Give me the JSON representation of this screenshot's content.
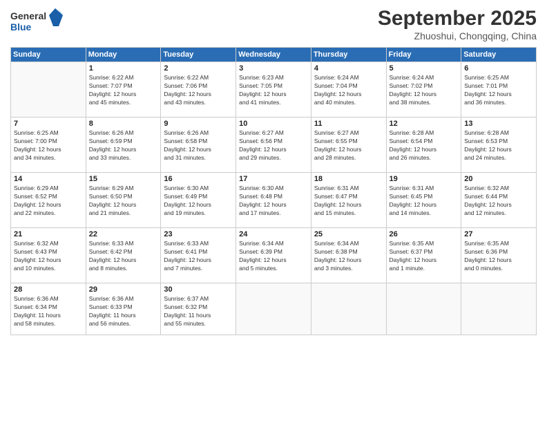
{
  "logo": {
    "line1": "General",
    "line2": "Blue"
  },
  "title": "September 2025",
  "subtitle": "Zhuoshui, Chongqing, China",
  "days_header": [
    "Sunday",
    "Monday",
    "Tuesday",
    "Wednesday",
    "Thursday",
    "Friday",
    "Saturday"
  ],
  "weeks": [
    [
      {
        "day": "",
        "info": ""
      },
      {
        "day": "1",
        "info": "Sunrise: 6:22 AM\nSunset: 7:07 PM\nDaylight: 12 hours\nand 45 minutes."
      },
      {
        "day": "2",
        "info": "Sunrise: 6:22 AM\nSunset: 7:06 PM\nDaylight: 12 hours\nand 43 minutes."
      },
      {
        "day": "3",
        "info": "Sunrise: 6:23 AM\nSunset: 7:05 PM\nDaylight: 12 hours\nand 41 minutes."
      },
      {
        "day": "4",
        "info": "Sunrise: 6:24 AM\nSunset: 7:04 PM\nDaylight: 12 hours\nand 40 minutes."
      },
      {
        "day": "5",
        "info": "Sunrise: 6:24 AM\nSunset: 7:02 PM\nDaylight: 12 hours\nand 38 minutes."
      },
      {
        "day": "6",
        "info": "Sunrise: 6:25 AM\nSunset: 7:01 PM\nDaylight: 12 hours\nand 36 minutes."
      }
    ],
    [
      {
        "day": "7",
        "info": "Sunrise: 6:25 AM\nSunset: 7:00 PM\nDaylight: 12 hours\nand 34 minutes."
      },
      {
        "day": "8",
        "info": "Sunrise: 6:26 AM\nSunset: 6:59 PM\nDaylight: 12 hours\nand 33 minutes."
      },
      {
        "day": "9",
        "info": "Sunrise: 6:26 AM\nSunset: 6:58 PM\nDaylight: 12 hours\nand 31 minutes."
      },
      {
        "day": "10",
        "info": "Sunrise: 6:27 AM\nSunset: 6:56 PM\nDaylight: 12 hours\nand 29 minutes."
      },
      {
        "day": "11",
        "info": "Sunrise: 6:27 AM\nSunset: 6:55 PM\nDaylight: 12 hours\nand 28 minutes."
      },
      {
        "day": "12",
        "info": "Sunrise: 6:28 AM\nSunset: 6:54 PM\nDaylight: 12 hours\nand 26 minutes."
      },
      {
        "day": "13",
        "info": "Sunrise: 6:28 AM\nSunset: 6:53 PM\nDaylight: 12 hours\nand 24 minutes."
      }
    ],
    [
      {
        "day": "14",
        "info": "Sunrise: 6:29 AM\nSunset: 6:52 PM\nDaylight: 12 hours\nand 22 minutes."
      },
      {
        "day": "15",
        "info": "Sunrise: 6:29 AM\nSunset: 6:50 PM\nDaylight: 12 hours\nand 21 minutes."
      },
      {
        "day": "16",
        "info": "Sunrise: 6:30 AM\nSunset: 6:49 PM\nDaylight: 12 hours\nand 19 minutes."
      },
      {
        "day": "17",
        "info": "Sunrise: 6:30 AM\nSunset: 6:48 PM\nDaylight: 12 hours\nand 17 minutes."
      },
      {
        "day": "18",
        "info": "Sunrise: 6:31 AM\nSunset: 6:47 PM\nDaylight: 12 hours\nand 15 minutes."
      },
      {
        "day": "19",
        "info": "Sunrise: 6:31 AM\nSunset: 6:45 PM\nDaylight: 12 hours\nand 14 minutes."
      },
      {
        "day": "20",
        "info": "Sunrise: 6:32 AM\nSunset: 6:44 PM\nDaylight: 12 hours\nand 12 minutes."
      }
    ],
    [
      {
        "day": "21",
        "info": "Sunrise: 6:32 AM\nSunset: 6:43 PM\nDaylight: 12 hours\nand 10 minutes."
      },
      {
        "day": "22",
        "info": "Sunrise: 6:33 AM\nSunset: 6:42 PM\nDaylight: 12 hours\nand 8 minutes."
      },
      {
        "day": "23",
        "info": "Sunrise: 6:33 AM\nSunset: 6:41 PM\nDaylight: 12 hours\nand 7 minutes."
      },
      {
        "day": "24",
        "info": "Sunrise: 6:34 AM\nSunset: 6:39 PM\nDaylight: 12 hours\nand 5 minutes."
      },
      {
        "day": "25",
        "info": "Sunrise: 6:34 AM\nSunset: 6:38 PM\nDaylight: 12 hours\nand 3 minutes."
      },
      {
        "day": "26",
        "info": "Sunrise: 6:35 AM\nSunset: 6:37 PM\nDaylight: 12 hours\nand 1 minute."
      },
      {
        "day": "27",
        "info": "Sunrise: 6:35 AM\nSunset: 6:36 PM\nDaylight: 12 hours\nand 0 minutes."
      }
    ],
    [
      {
        "day": "28",
        "info": "Sunrise: 6:36 AM\nSunset: 6:34 PM\nDaylight: 11 hours\nand 58 minutes."
      },
      {
        "day": "29",
        "info": "Sunrise: 6:36 AM\nSunset: 6:33 PM\nDaylight: 11 hours\nand 56 minutes."
      },
      {
        "day": "30",
        "info": "Sunrise: 6:37 AM\nSunset: 6:32 PM\nDaylight: 11 hours\nand 55 minutes."
      },
      {
        "day": "",
        "info": ""
      },
      {
        "day": "",
        "info": ""
      },
      {
        "day": "",
        "info": ""
      },
      {
        "day": "",
        "info": ""
      }
    ]
  ]
}
